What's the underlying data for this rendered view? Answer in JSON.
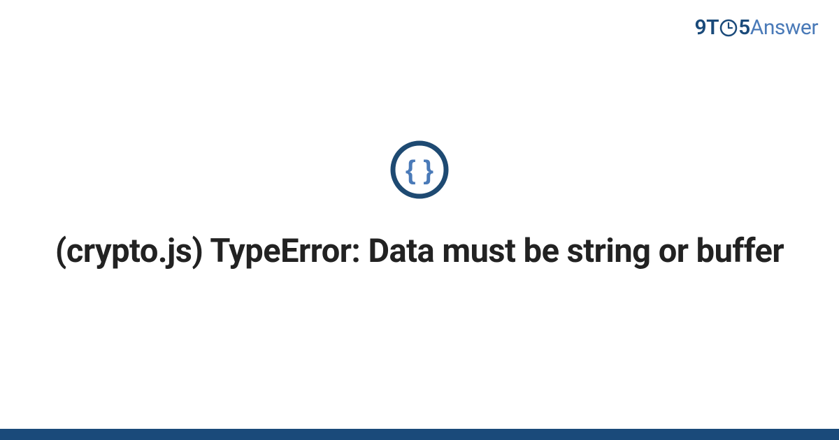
{
  "logo": {
    "part1": "9T",
    "part2": "5",
    "part3": "Answer"
  },
  "main": {
    "icon_name": "code-braces-icon",
    "title": "(crypto.js) TypeError: Data must be string or buffer"
  },
  "colors": {
    "primary_dark": "#1a4a7a",
    "primary_light": "#4a7ab8",
    "icon_border": "#1e4a72",
    "icon_content": "#4a7ab8",
    "text": "#222222"
  }
}
